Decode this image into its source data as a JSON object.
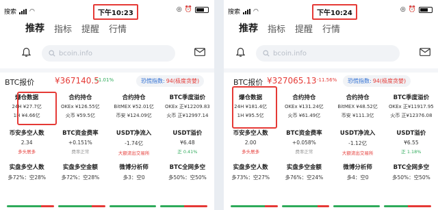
{
  "left": {
    "status": {
      "carrier": "搜索",
      "time": "下午10:23"
    },
    "tabs": [
      "推荐",
      "指标",
      "提醒",
      "行情"
    ],
    "search_placeholder": "bcoin.info",
    "price": {
      "label": "BTC报价",
      "value": "¥367140.5",
      "change": "+1.01%",
      "change_dir": "up"
    },
    "fear": {
      "label": "恐慌指数:",
      "value": "94(极度贪婪)"
    },
    "row1": [
      {
        "title": "爆仓数据",
        "lines": [
          "24H ¥27.7亿",
          "1H ¥4.66亿"
        ]
      },
      {
        "title": "合约持仓",
        "lines": [
          "OKEx ¥126.55亿",
          "火币 ¥59.5亿"
        ]
      },
      {
        "title": "合约持仓",
        "lines": [
          "BitMEX ¥52.01亿",
          "币安 ¥124.09亿"
        ]
      },
      {
        "title": "BTC季度溢价",
        "lines": [
          "OKEx 正¥12209.83",
          "火币 正¥12997.14"
        ]
      }
    ],
    "row2": [
      {
        "title": "币安多空人数",
        "value": "2.34",
        "sub": "多头居多",
        "sub_color": "red"
      },
      {
        "title": "BTC资金费率",
        "value": "+0.151%",
        "sub": "费率正常",
        "sub_color": "gray"
      },
      {
        "title": "USDT净流入",
        "value": "-1.74亿",
        "sub": "大额流出交易所",
        "sub_color": "red"
      },
      {
        "title": "USDT溢价",
        "value": "¥6.48",
        "sub": "正 0.41%",
        "sub_color": "green"
      }
    ],
    "row3": [
      {
        "title": "实盘多空人数",
        "value": "多72%：空28%"
      },
      {
        "title": "实盘多空金额",
        "value": "多72%：空28%"
      },
      {
        "title": "微博分析师",
        "value": "多3：空0"
      },
      {
        "title": "BTC全网多空",
        "value": "多50%：空50%"
      }
    ],
    "bar_long": [
      72,
      72,
      100,
      50
    ]
  },
  "right": {
    "status": {
      "carrier": "搜索",
      "time": "下午10:24"
    },
    "tabs": [
      "推荐",
      "指标",
      "提醒",
      "行情"
    ],
    "search_placeholder": "bcoin.info",
    "price": {
      "label": "BTC报价",
      "value": "¥327065.13",
      "change": "-11.56%",
      "change_dir": "down"
    },
    "fear": {
      "label": "恐慌指数:",
      "value": "94(极度贪婪)"
    },
    "row1": [
      {
        "title": "爆仓数据",
        "lines": [
          "24H ¥181.4亿",
          "1H ¥95.5亿"
        ]
      },
      {
        "title": "合约持仓",
        "lines": [
          "OKEx ¥131.24亿",
          "火币 ¥61.49亿"
        ]
      },
      {
        "title": "合约持仓",
        "lines": [
          "BitMEX ¥48.52亿",
          "币安 ¥111.3亿"
        ]
      },
      {
        "title": "BTC季度溢价",
        "lines": [
          "OKEx 正¥11917.95",
          "火币 正¥12376.08"
        ]
      }
    ],
    "row2": [
      {
        "title": "币安多空人数",
        "value": "2.00",
        "sub": "多头居多",
        "sub_color": "red"
      },
      {
        "title": "BTC资金费率",
        "value": "+0.058%",
        "sub": "费率正常",
        "sub_color": "gray"
      },
      {
        "title": "USDT净流入",
        "value": "-1.12亿",
        "sub": "大额流出交易所",
        "sub_color": "red"
      },
      {
        "title": "USDT溢价",
        "value": "¥6.55",
        "sub": "正 1.18%",
        "sub_color": "green"
      }
    ],
    "row3": [
      {
        "title": "实盘多空人数",
        "value": "多73%：空27%"
      },
      {
        "title": "实盘多空金额",
        "value": "多76%：空24%"
      },
      {
        "title": "微博分析师",
        "value": "多4：空0"
      },
      {
        "title": "BTC全网多空",
        "value": "多50%：空50%"
      }
    ],
    "bar_long": [
      73,
      76,
      100,
      50
    ]
  },
  "colors": {
    "red": "#e53935",
    "green": "#2eaa5a",
    "blue": "#2e6fd3"
  },
  "icons": [
    "search-icon",
    "bell-icon",
    "mail-icon",
    "wifi-icon",
    "alarm-icon",
    "battery-icon"
  ]
}
